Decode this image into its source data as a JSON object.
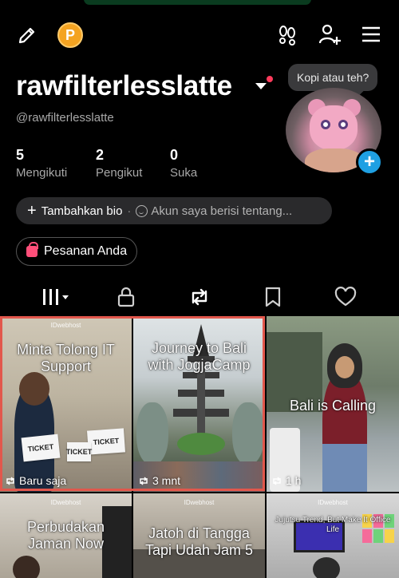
{
  "header": {
    "edit_icon": "pencil-icon",
    "points_badge": "P",
    "icons": [
      "footprints-icon",
      "add-friend-icon",
      "menu-icon"
    ]
  },
  "tooltip": "Kopi atau teh?",
  "profile": {
    "username": "rawfilterlesslatte",
    "handle": "@rawfilterlesslatte",
    "stats": [
      {
        "value": "5",
        "label": "Mengikuti"
      },
      {
        "value": "2",
        "label": "Pengikut"
      },
      {
        "value": "0",
        "label": "Suka"
      }
    ],
    "add_bio_label": "Tambahkan bio",
    "bio_placeholder": "Akun saya berisi tentang...",
    "orders_label": "Pesanan Anda"
  },
  "tabs": [
    "grid-icon",
    "lock-icon",
    "repost-icon",
    "bookmark-icon",
    "heart-icon"
  ],
  "videos": [
    {
      "caption": "Minta Tolong IT Support",
      "views": "Baru saja",
      "brand": "IDwebhost"
    },
    {
      "caption": "Journey to Bali with JogjaCamp",
      "views": "3 mnt"
    },
    {
      "caption": "Bali is Calling",
      "views": "1 h"
    },
    {
      "caption": "Perbudakan Jaman Now",
      "brand": "IDwebhost"
    },
    {
      "caption": "Jatoh di Tangga Tapi Udah Jam 5",
      "brand": "IDwebhost"
    },
    {
      "caption": "Jujutsu Trend, But Make It Office Life",
      "brand": "IDwebhost"
    }
  ],
  "ticket_text": "TICKET",
  "colors": {
    "background": "#000000",
    "accent_blue": "#1fa0e3",
    "badge_orange": "#f4a321",
    "highlight_red": "#e2574c",
    "notification_red": "#ff3b5c"
  }
}
